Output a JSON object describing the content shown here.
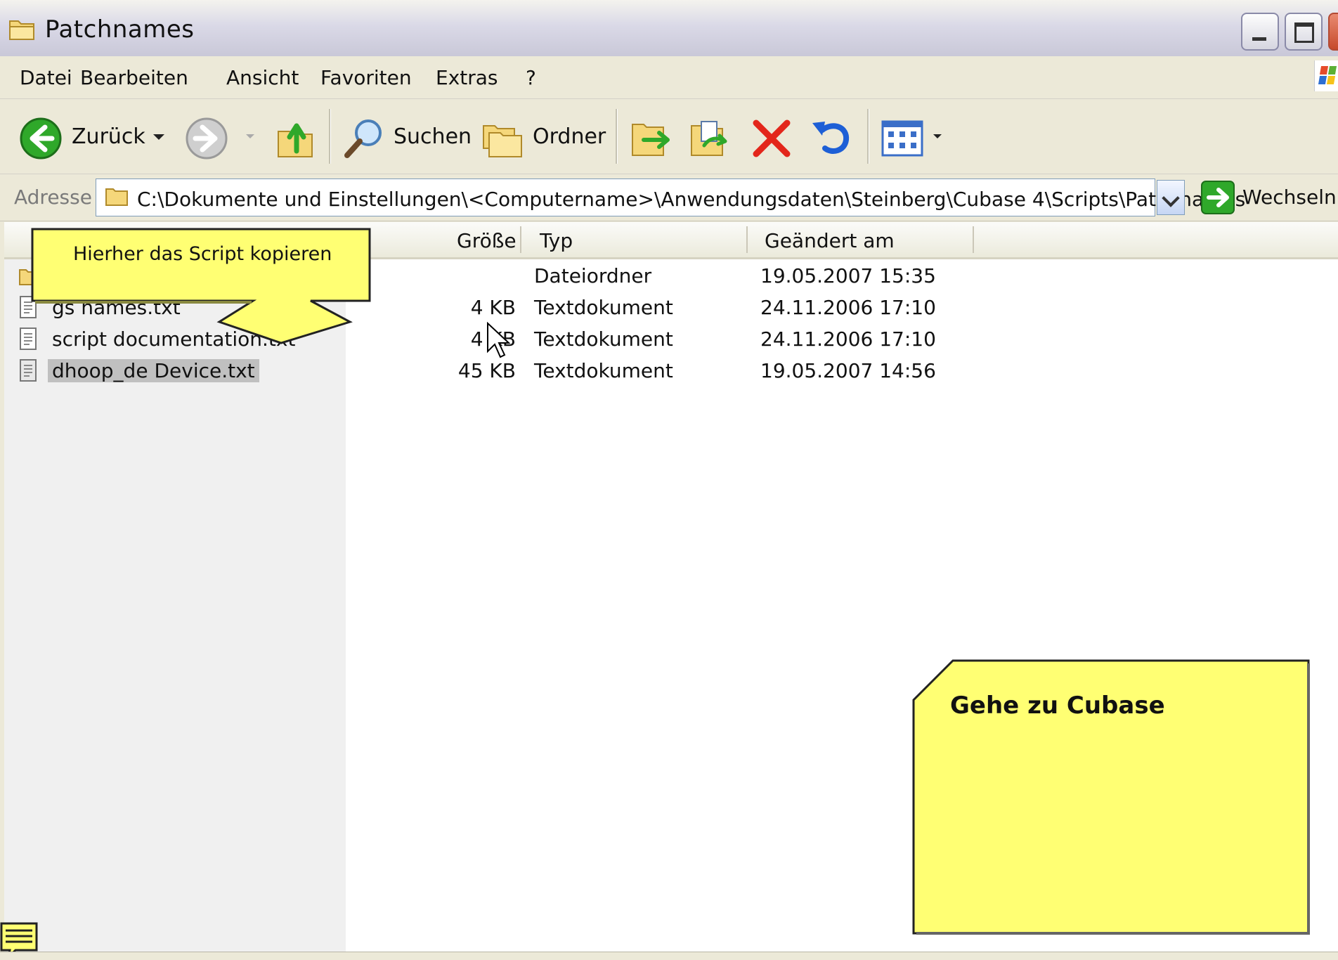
{
  "window": {
    "title": "Patchnames"
  },
  "menu": [
    "Datei",
    "Bearbeiten",
    "Ansicht",
    "Favoriten",
    "Extras",
    "?"
  ],
  "toolbar": {
    "back_label": "Zurück",
    "search_label": "Suchen",
    "folders_label": "Ordner",
    "icons": [
      "back-icon",
      "forward-icon",
      "up-folder-icon",
      "search-icon",
      "folders-icon",
      "move-to-icon",
      "copy-to-icon",
      "delete-icon",
      "undo-icon",
      "views-icon"
    ]
  },
  "address": {
    "label": "Adresse",
    "value": "C:\\Dokumente und Einstellungen\\<Computername>\\Anwendungsdaten\\Steinberg\\Cubase 4\\Scripts\\Patchnames",
    "go_label": "Wechseln zu"
  },
  "columns": {
    "size": "Größe",
    "type": "Typ",
    "modified": "Geändert am"
  },
  "files": [
    {
      "name": "",
      "size": "",
      "type": "Dateiordner",
      "modified": "19.05.2007 15:35"
    },
    {
      "name": "gs names.txt",
      "size": "4 KB",
      "type": "Textdokument",
      "modified": "24.11.2006 17:10"
    },
    {
      "name": "script documentation.txt",
      "size": "4 KB",
      "type": "Textdokument",
      "modified": "24.11.2006 17:10"
    },
    {
      "name": "dhoop_de Device.txt",
      "size": "45 KB",
      "type": "Textdokument",
      "modified": "19.05.2007 14:56"
    }
  ],
  "callouts": {
    "copy_here": "Hierher das Script kopieren",
    "go_cubase": "Gehe zu Cubase"
  },
  "colors": {
    "callout_fill": "#ffff73",
    "selection": "#c0c0c0",
    "delete_red": "#e3261b",
    "back_green": "#2fa82a"
  }
}
